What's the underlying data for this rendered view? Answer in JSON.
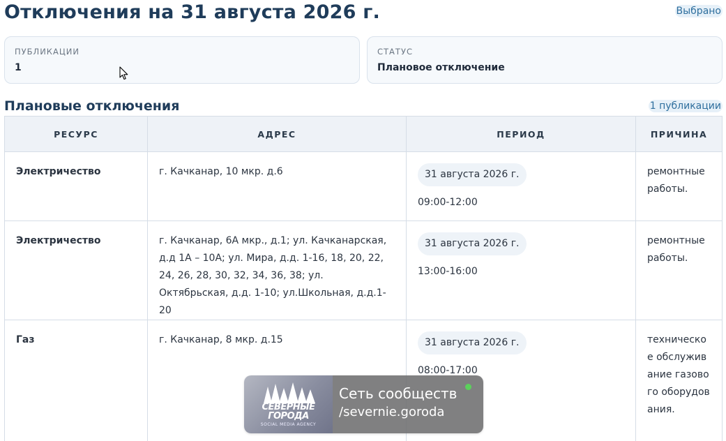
{
  "header": {
    "title": "Отключения на 31 августа 2026 г.",
    "selected_label": "Выбрано"
  },
  "summary": {
    "publications": {
      "label": "ПУБЛИКАЦИИ",
      "value": "1"
    },
    "status": {
      "label": "СТАТУС",
      "value": "Плановое отключение"
    }
  },
  "section": {
    "title": "Плановые отключения",
    "count_label": "1 публикации"
  },
  "table": {
    "columns": [
      "РЕСУРС",
      "АДРЕС",
      "ПЕРИОД",
      "ПРИЧИНА"
    ],
    "rows": [
      {
        "resource": "Электричество",
        "address": "г. Качканар, 10 мкр. д.6",
        "date": "31 августа 2026 г.",
        "time": "09:00-12:00",
        "reason": "ремонтные работы."
      },
      {
        "resource": "Электричество",
        "address": "г. Качканар, 6А мкр., д.1; ул. Качканарская, д.д 1А – 10А; ул. Мира, д.д. 1-16, 18, 20, 22, 24, 26, 28, 30, 32, 34, 36, 38; ул. Октябрьская, д.д. 1-10; ул.Школьная, д.д.1-20",
        "date": "31 августа 2026 г.",
        "time": "13:00-16:00",
        "reason": "ремонтные работы."
      },
      {
        "resource": "Газ",
        "address": "г. Качканар, 8 мкр. д.15",
        "date": "31 августа 2026 г.",
        "time": "08:00-17:00",
        "reason": "техническое обслуживание газового оборудования."
      }
    ]
  },
  "overlay": {
    "logo_line1": "СЕВЕРНЫЕ",
    "logo_line2": "ГОРОДА",
    "logo_sub": "SOCIAL MEDIA AGENCY",
    "line1": "Сеть сообществ",
    "line2": "/severnie.goroda",
    "dot_color": "#5bd15b"
  },
  "colors": {
    "title": "#1f3c5a",
    "badge_text": "#2f6f9e",
    "badge_bg": "#e6f0f8",
    "table_header_bg": "#eef2f7"
  }
}
